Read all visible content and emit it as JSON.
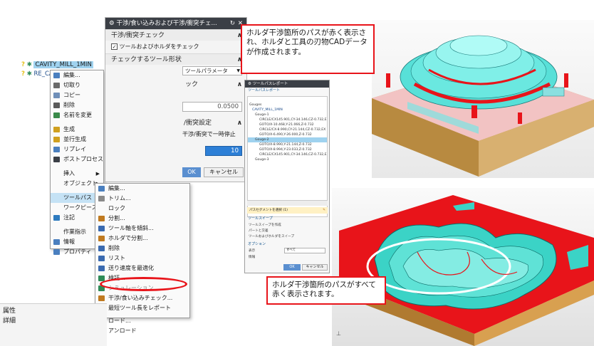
{
  "tree": {
    "items": [
      {
        "label": "CAVITY_MILL_1MIN"
      },
      {
        "label": "RE_CA"
      }
    ]
  },
  "context_menu": {
    "items": [
      {
        "label": "編集..."
      },
      {
        "label": "切取り"
      },
      {
        "label": "コピー"
      },
      {
        "label": "削除"
      },
      {
        "label": "名前を変更"
      },
      {
        "label": "生成"
      },
      {
        "label": "並行生成"
      },
      {
        "label": "リプレイ"
      },
      {
        "label": "ポストプロセス"
      },
      {
        "label": "挿入"
      },
      {
        "label": "オブジェクト"
      },
      {
        "label": "ツールパス"
      },
      {
        "label": "ワークピース"
      },
      {
        "label": "注記"
      },
      {
        "label": "作業指示"
      },
      {
        "label": "情報"
      },
      {
        "label": "プロパティ"
      }
    ]
  },
  "submenu": {
    "items": [
      {
        "label": "編集..."
      },
      {
        "label": "トリム..."
      },
      {
        "label": "ロック"
      },
      {
        "label": "分割..."
      },
      {
        "label": "ツール軸を傾斜..."
      },
      {
        "label": "ホルダで分割..."
      },
      {
        "label": "削除"
      },
      {
        "label": "リスト"
      },
      {
        "label": "送り速度を最適化"
      },
      {
        "label": "検証..."
      },
      {
        "label": "シミュレーション"
      },
      {
        "label": "干渉/食い込みチェック..."
      },
      {
        "label": "最短ツール長をレポート"
      },
      {
        "label": "ロード..."
      },
      {
        "label": "アンロード"
      }
    ]
  },
  "dialog": {
    "title": "干渉/食い込みおよび干渉/衝突チェ...",
    "section_check": "干渉/衝突チェック",
    "checkbox_label": "ツールおよびホルダをチェック",
    "section_tool_shape": "チェックするツール形状",
    "dropdown_value": "ツールパラメータ",
    "section_check2": "ック",
    "value_tolerance": "0.0500",
    "section_settings": "/衝突設定",
    "stop_label": "干渉/衝突で一時停止",
    "value_count": "10",
    "ok_label": "OK",
    "cancel_label": "キャンセル"
  },
  "bottom_left": {
    "row1": "属性",
    "row2": "詳細"
  },
  "report": {
    "title": "ツールパスレポート",
    "section_report": "ツールパスレポート",
    "gouges_label": "Gouges",
    "op_name": "CAVITY_MILL_1MIN",
    "gouge1": "Gouge-1",
    "gouge1_lines": [
      "CIRCLE/CX145.901,CY-34.146,CZ-0.732,EX",
      "GOTO/X-10.468,Y-21.066,Z-0.732",
      "CIRCLE/CX-8.990,CY-21.144,CZ-0.732,EX",
      "GOTO/X-6.490,Y-26.000,Z-0.732"
    ],
    "gouge2": "Gouge-2",
    "gouge2_lines": [
      "GOTO/X-8.990,Y-21.144,Z-0.732",
      "GOTO/X-8.994,Y-23.033,Z-0.732",
      "CIRCLE/CX145.901,CY-34.146,CZ-0.732,EX"
    ],
    "gouge3": "Gouge-3",
    "segment_select": "パスセグメントを選択 (1)",
    "section_tooltip": "ツールスイープ",
    "sweep_create": "ツールスイープを作成",
    "part_align": "パートと交差",
    "sweep_check": "ツールおよびホルダをスイープ",
    "section_options": "オプション",
    "display_label": "表示",
    "display_value": "すべて",
    "info_label": "情報",
    "ok_label": "OK",
    "cancel_label": "キャンセル"
  },
  "callouts": {
    "top": "ホルダ干渉箇所のパスが赤く表示され、ホルダと工具の刃物CADデータが作成されます。",
    "bottom": "ホルダ干渉箇所のパスがすべて赤く表示されます。"
  },
  "colors": {
    "gouge_red": "#e8141a",
    "part_cyan": "#38d6c4",
    "highlight_blue": "#9fd2ef",
    "tree_icon_yellow": "#e5c01a"
  }
}
